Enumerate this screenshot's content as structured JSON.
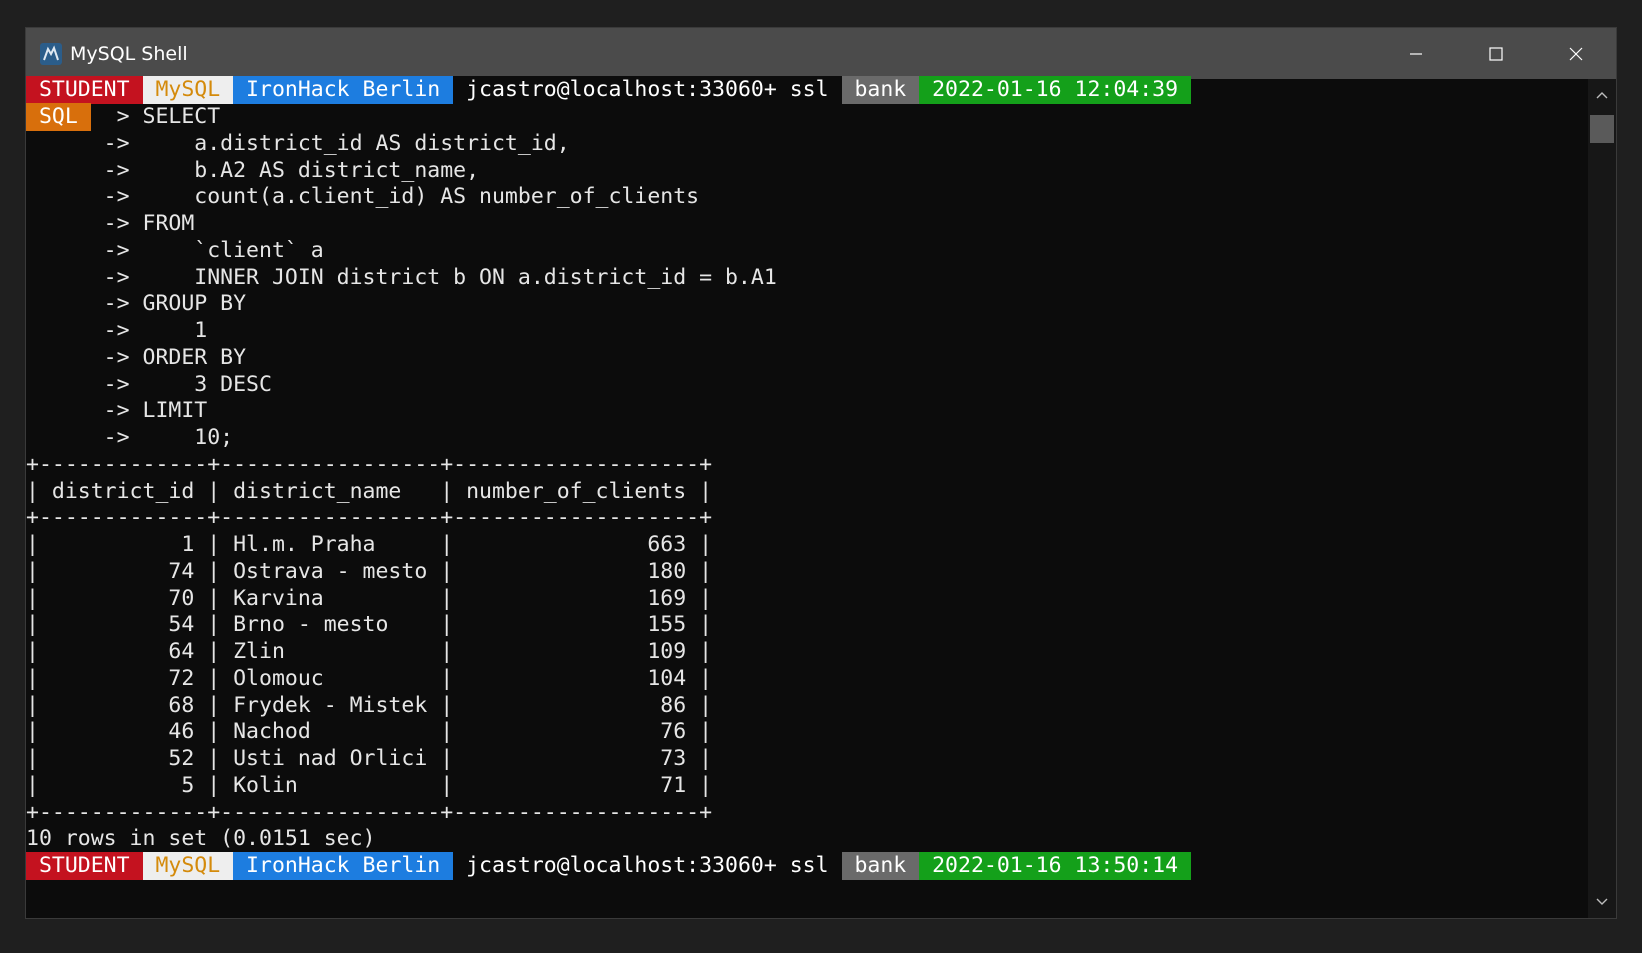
{
  "window": {
    "title": "MySQL Shell"
  },
  "prompt_top": {
    "student": " STUDENT ",
    "mysql": " MySQL ",
    "host": " IronHack Berlin ",
    "user": " jcastro@localhost:33060+ ssl ",
    "schema": " bank ",
    "time": " 2022-01-16 12:04:39 ",
    "mode": " SQL ",
    "mode_suffix": "  > SELECT"
  },
  "query_lines": [
    "      ->     a.district_id AS district_id,",
    "      ->     b.A2 AS district_name,",
    "      ->     count(a.client_id) AS number_of_clients",
    "      -> FROM",
    "      ->     `client` a",
    "      ->     INNER JOIN district b ON a.district_id = b.A1",
    "      -> GROUP BY",
    "      ->     1",
    "      -> ORDER BY",
    "      ->     3 DESC",
    "      -> LIMIT",
    "      ->     10;"
  ],
  "result_table": {
    "border_top": "+-------------+-----------------+-------------------+",
    "header": "| district_id | district_name   | number_of_clients |",
    "border_mid": "+-------------+-----------------+-------------------+",
    "rows": [
      "|           1 | Hl.m. Praha     |               663 |",
      "|          74 | Ostrava - mesto |               180 |",
      "|          70 | Karvina         |               169 |",
      "|          54 | Brno - mesto    |               155 |",
      "|          64 | Zlin            |               109 |",
      "|          72 | Olomouc         |               104 |",
      "|          68 | Frydek - Mistek |                86 |",
      "|          46 | Nachod          |                76 |",
      "|          52 | Usti nad Orlici |                73 |",
      "|           5 | Kolin           |                71 |"
    ],
    "border_bottom": "+-------------+-----------------+-------------------+",
    "summary": "10 rows in set (0.0151 sec)"
  },
  "prompt_bottom": {
    "student": " STUDENT ",
    "mysql": " MySQL ",
    "host": " IronHack Berlin ",
    "user": " jcastro@localhost:33060+ ssl ",
    "schema": " bank ",
    "time": " 2022-01-16 13:50:14 "
  },
  "icons": {
    "app": "mysql-dolphin-icon",
    "minimize": "minimize-icon",
    "maximize": "maximize-icon",
    "close": "close-icon"
  },
  "colors": {
    "student_bg": "#c4121f",
    "mysql_bg": "#eeeeee",
    "mysql_fg": "#d48a0b",
    "host_bg": "#1d7de0",
    "schema_bg": "#6a6a6a",
    "time_bg": "#14a01a",
    "mode_bg": "#d86f0c"
  }
}
